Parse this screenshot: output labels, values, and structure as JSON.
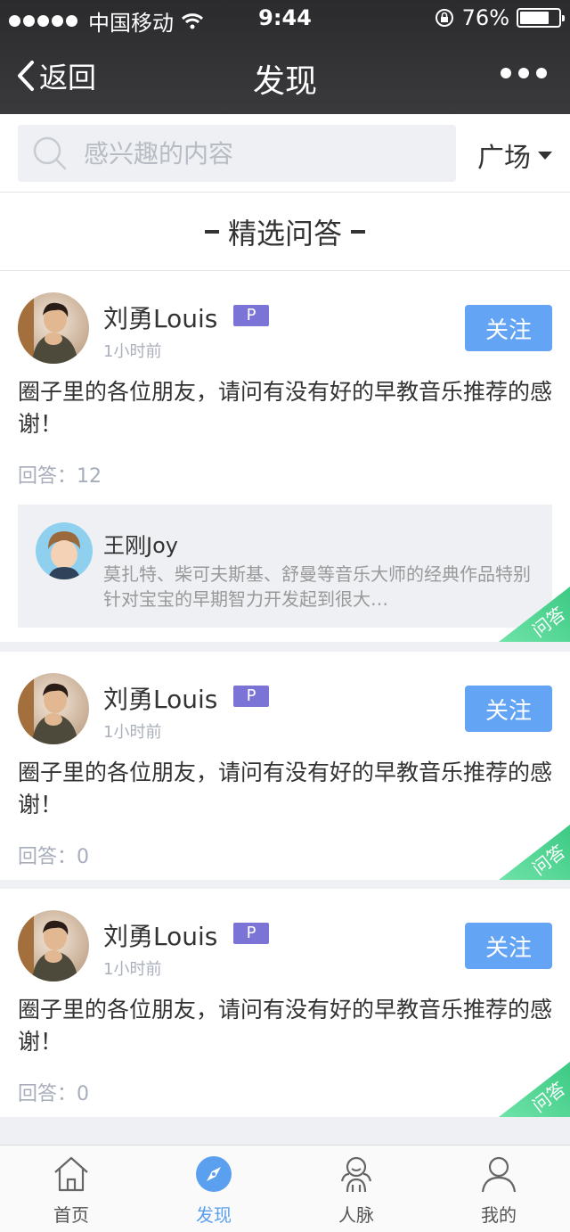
{
  "status_bar": {
    "carrier": "中国移动",
    "time": "9:44",
    "battery_pct": "76%",
    "battery_level": 0.76
  },
  "nav": {
    "back_label": "返回",
    "title": "发现"
  },
  "search": {
    "placeholder": "感兴趣的内容",
    "filter_label": "广场"
  },
  "section": {
    "title": "精选问答"
  },
  "tag_label": "问答",
  "cards": [
    {
      "user": "刘勇Louis",
      "badge": "P",
      "time": "1小时前",
      "follow_label": "关注",
      "content": "圈子里的各位朋友，请问有没有好的早教音乐推荐的感谢！",
      "answers": "回答：12",
      "reply": {
        "user": "王刚Joy",
        "text": "莫扎特、柴可夫斯基、舒曼等音乐大师的经典作品特别针对宝宝的早期智力开发起到很大…"
      }
    },
    {
      "user": "刘勇Louis",
      "badge": "P",
      "time": "1小时前",
      "follow_label": "关注",
      "content": "圈子里的各位朋友，请问有没有好的早教音乐推荐的感谢！",
      "answers": "回答：0"
    },
    {
      "user": "刘勇Louis",
      "badge": "P",
      "time": "1小时前",
      "follow_label": "关注",
      "content": "圈子里的各位朋友，请问有没有好的早教音乐推荐的感谢！",
      "answers": "回答：0"
    }
  ],
  "tabs": [
    {
      "label": "首页",
      "icon": "home-icon",
      "active": false
    },
    {
      "label": "发现",
      "icon": "compass-icon",
      "active": true
    },
    {
      "label": "人脉",
      "icon": "contacts-icon",
      "active": false
    },
    {
      "label": "我的",
      "icon": "profile-icon",
      "active": false
    }
  ],
  "colors": {
    "accent": "#63a4f5",
    "badge": "#7b74d6",
    "tag_green": "#4cd68e",
    "tab_active": "#5aa0ee"
  }
}
